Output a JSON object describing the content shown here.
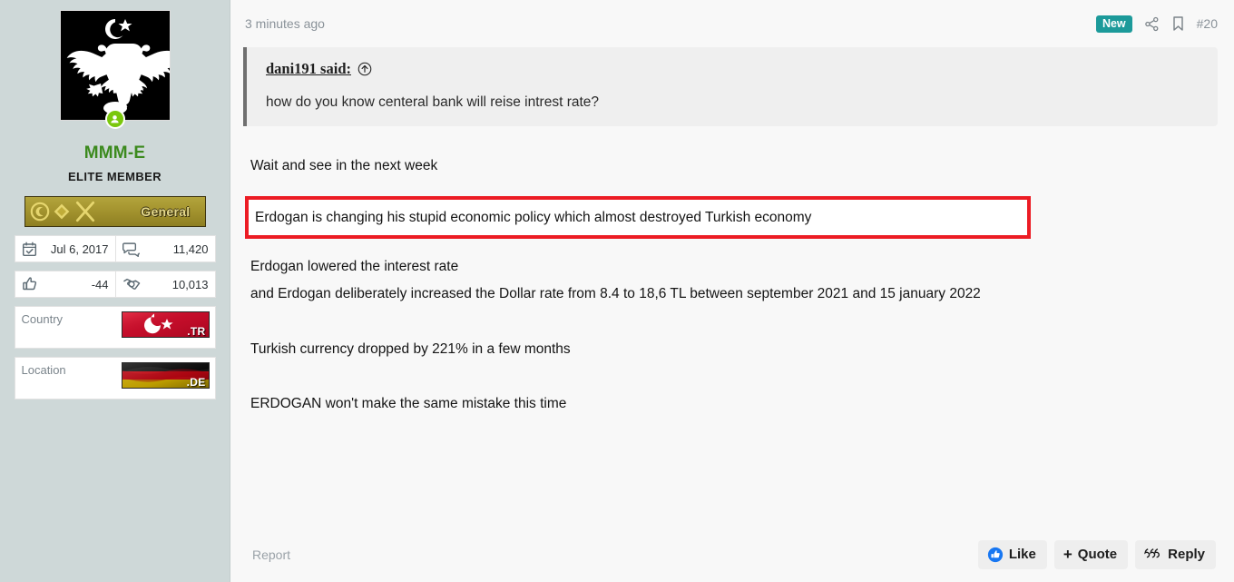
{
  "sidebar": {
    "avatar": {
      "icon": "double-headed-eagle-emblem",
      "online_status_icon": "online-user-icon"
    },
    "username": "MMM-E",
    "user_title": "ELITE MEMBER",
    "rank_badge": {
      "label": "General",
      "icons": [
        "crescent-star-medal-icon",
        "diamond-insignia-icon",
        "crossed-swords-icon"
      ]
    },
    "stats": [
      [
        {
          "icon": "calendar-check-icon",
          "value": "Jul 6, 2017",
          "name": "joined-date"
        },
        {
          "icon": "comments-icon",
          "value": "11,420",
          "name": "messages-count"
        }
      ],
      [
        {
          "icon": "thumbs-up-icon",
          "value": "-44",
          "name": "reaction-score"
        },
        {
          "icon": "handshake-icon",
          "value": "10,013",
          "name": "points-count"
        }
      ]
    ],
    "info": [
      {
        "label": "Country",
        "flag_icon": "flag-turkey",
        "tld": ".TR",
        "name": "country-row"
      },
      {
        "label": "Location",
        "flag_icon": "flag-germany",
        "tld": ".DE",
        "name": "location-row"
      }
    ]
  },
  "header": {
    "timestamp": "3 minutes ago",
    "new_badge": "New",
    "share_icon": "share-icon",
    "bookmark_icon": "bookmark-icon",
    "post_number": "#20"
  },
  "quote": {
    "attribution": "dani191 said:",
    "jump_icon": "arrow-up-circle-icon",
    "text": "how do you know centeral bank will reise intrest rate?"
  },
  "post_body": {
    "paragraph_1": "Wait and see in the next week",
    "highlight": "Erdogan is changing his stupid economic policy which almost destroyed Turkish economy",
    "paragraph_2_line_1": "Erdogan lowered the interest rate",
    "paragraph_2_line_2": "and Erdogan deliberately increased the Dollar rate from 8.4 to 18,6 TL between september 2021 and 15 january 2022",
    "paragraph_3": "Turkish currency dropped by 221% in a few months",
    "paragraph_4": "ERDOGAN won't make the same mistake this time"
  },
  "footer": {
    "report_label": "Report",
    "like_label": "Like",
    "quote_label": "Quote",
    "quote_glyph": "+",
    "reply_label": "Reply",
    "like_icon": "thumbs-up-circle-icon",
    "reply_icon": "quote-marks-icon"
  },
  "colors": {
    "sidebar_background": "#ced8d8",
    "content_background": "#f8f8f8",
    "username": "#3c8a1e",
    "new_badge": "#1c9a9a",
    "highlight_border": "#ec1c24",
    "like_icon": "#1877f2",
    "online_badge": "#7ac70c"
  }
}
